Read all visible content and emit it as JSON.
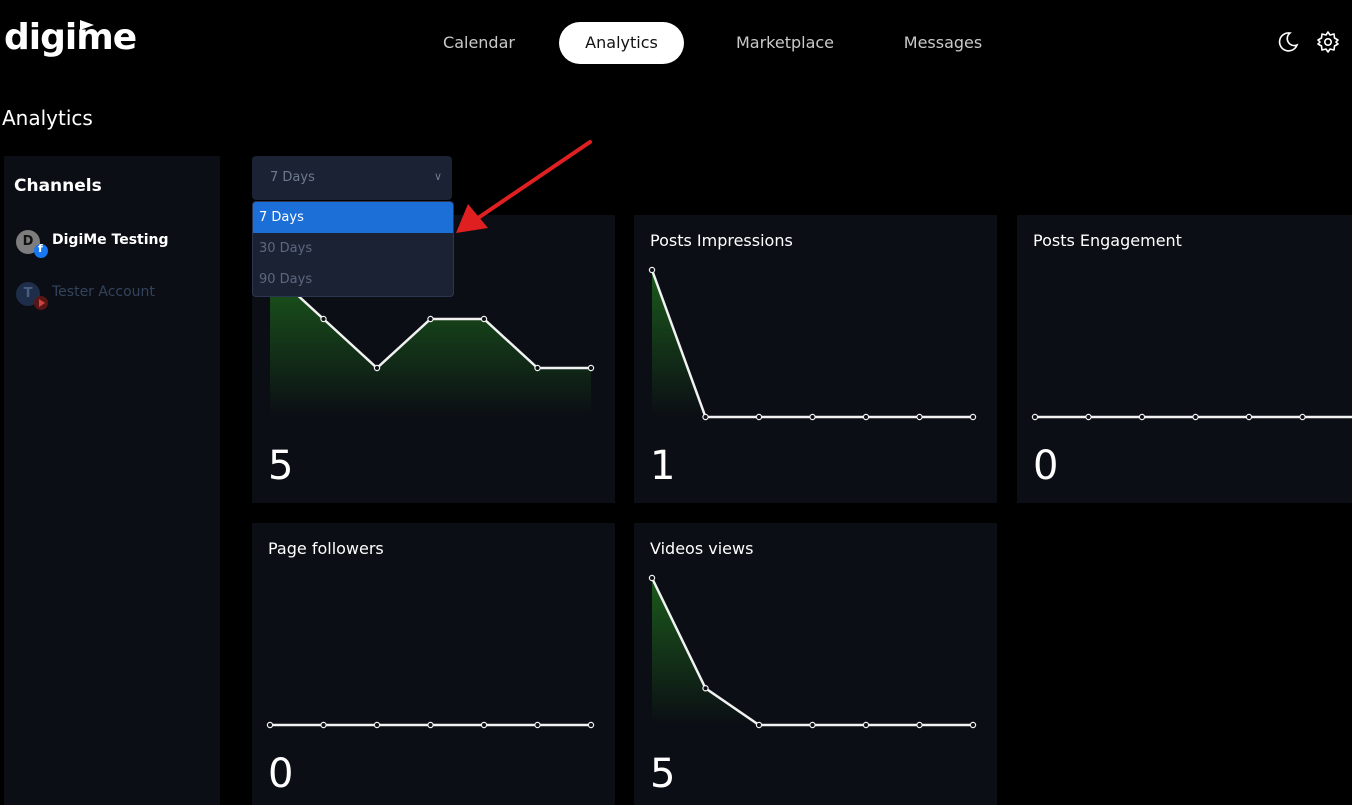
{
  "header": {
    "logo": "digime",
    "tabs": [
      {
        "label": "Calendar"
      },
      {
        "label": "Analytics"
      },
      {
        "label": "Marketplace"
      },
      {
        "label": "Messages"
      }
    ],
    "active_tab": "Analytics",
    "icons": [
      "moon-icon",
      "gear-icon"
    ]
  },
  "page": {
    "title": "Analytics"
  },
  "sidebar": {
    "heading": "Channels",
    "channels": [
      {
        "initial": "D",
        "name": "DigiMe Testing",
        "platform": "facebook",
        "selected": true
      },
      {
        "initial": "T",
        "name": "Tester Account",
        "platform": "youtube",
        "selected": false
      }
    ]
  },
  "period_select": {
    "value": "7 Days",
    "options": [
      "7 Days",
      "30 Days",
      "90 Days"
    ],
    "highlighted": "7 Days"
  },
  "colors": {
    "accent": "#1d6fd8",
    "chart_fill": "#1c5e1c",
    "card_bg": "#0b0e14",
    "arrow": "#e02020"
  },
  "cards": [
    {
      "title": "",
      "value": "5",
      "chart_data": {
        "type": "area",
        "values": [
          3,
          2,
          1,
          2,
          2,
          1,
          1
        ]
      }
    },
    {
      "title": "Posts Impressions",
      "value": "1",
      "chart_data": {
        "type": "area",
        "values": [
          1,
          0,
          0,
          0,
          0,
          0,
          0
        ]
      }
    },
    {
      "title": "Posts Engagement",
      "value": "0",
      "chart_data": {
        "type": "area",
        "values": [
          0,
          0,
          0,
          0,
          0,
          0,
          0
        ]
      }
    },
    {
      "title": "Page followers",
      "value": "0",
      "chart_data": {
        "type": "area",
        "values": [
          0,
          0,
          0,
          0,
          0,
          0,
          0
        ]
      }
    },
    {
      "title": "Videos views",
      "value": "5",
      "chart_data": {
        "type": "area",
        "values": [
          4,
          1,
          0,
          0,
          0,
          0,
          0
        ]
      }
    }
  ]
}
